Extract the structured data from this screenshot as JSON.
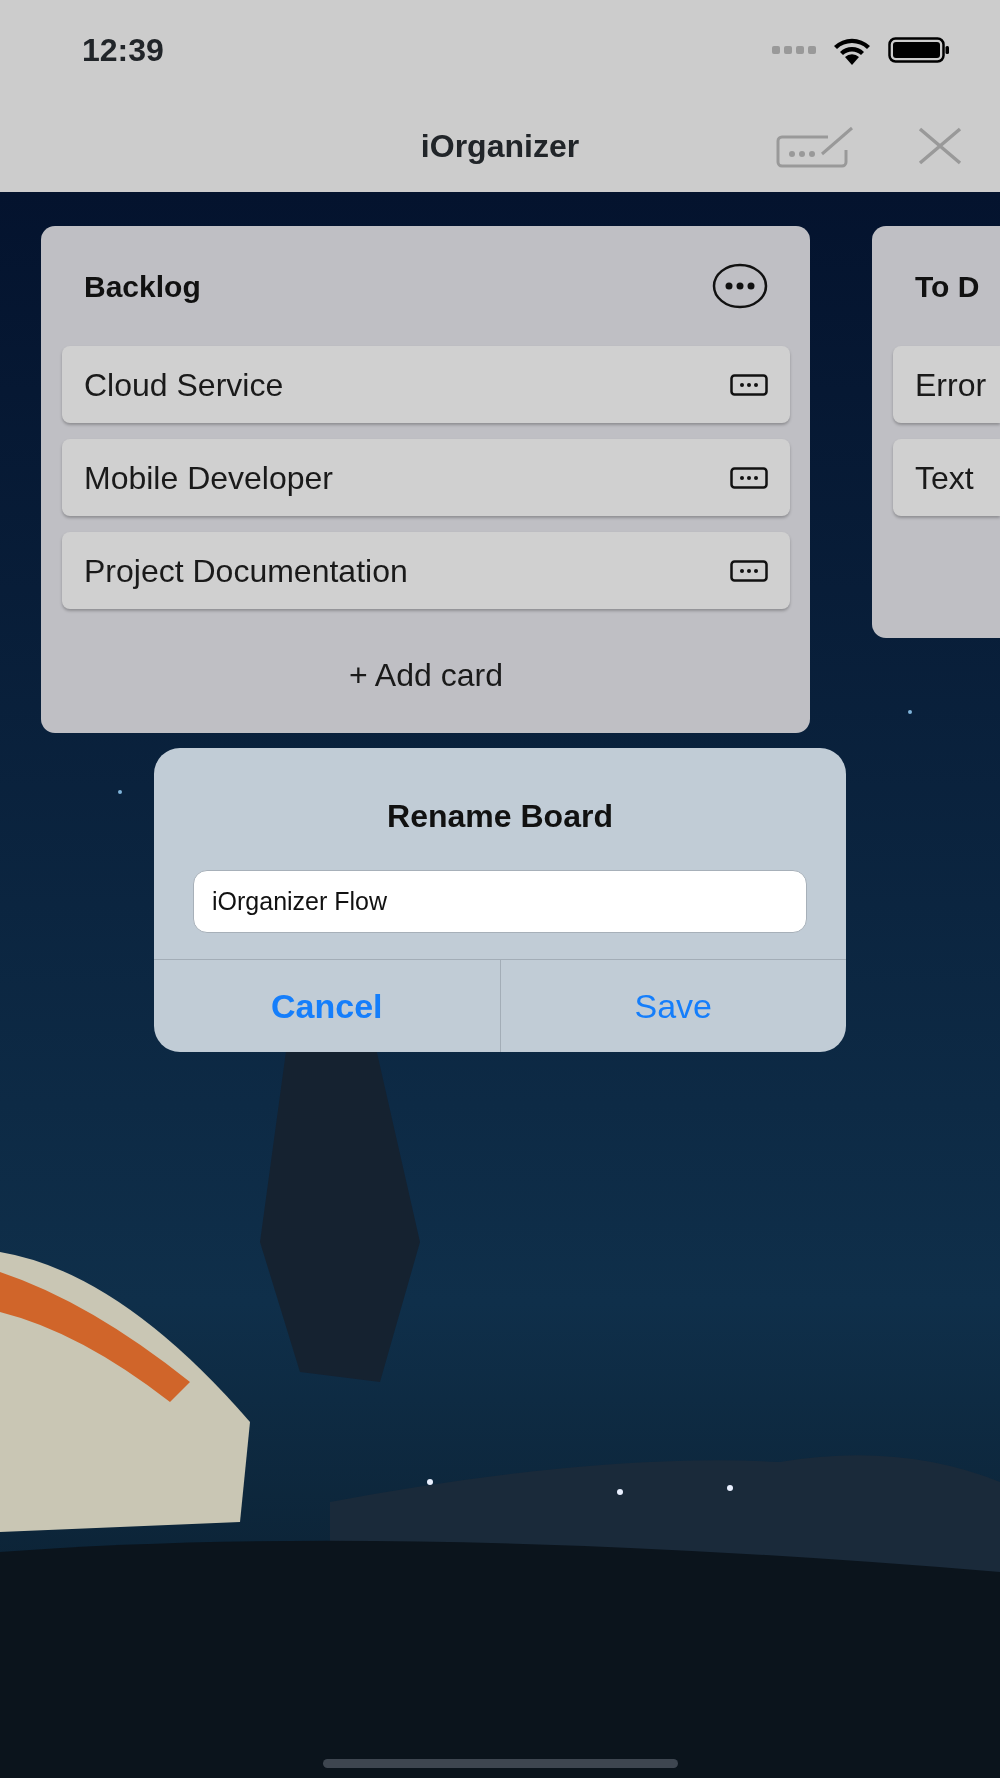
{
  "status_bar": {
    "time": "12:39"
  },
  "nav_bar": {
    "title": "iOrganizer"
  },
  "lists": [
    {
      "title": "Backlog",
      "cards": [
        {
          "title": "Cloud Service"
        },
        {
          "title": "Mobile Developer"
        },
        {
          "title": "Project Documentation"
        }
      ],
      "add_card": "+ Add card"
    },
    {
      "title": "To D",
      "cards": [
        {
          "title": "Error"
        },
        {
          "title": "Text"
        }
      ]
    }
  ],
  "dialog": {
    "title": "Rename Board",
    "field": {
      "value": "iOrganizer Flow"
    },
    "buttons": [
      {
        "label": "Cancel",
        "kind": "cancel"
      },
      {
        "label": "Save",
        "kind": "default"
      }
    ]
  }
}
